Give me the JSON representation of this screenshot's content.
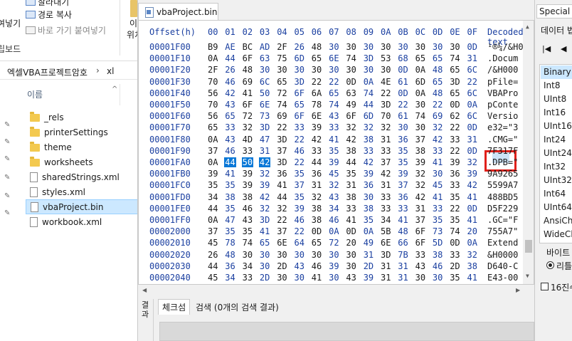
{
  "explorer": {
    "ribbon": {
      "item_top": "잘라내기",
      "copy_path": "경로 복사",
      "paste_shortcut": "바로 가기 붙여넣기",
      "left_fragment": "여넣기",
      "clipboard_group": "립보드",
      "right_fragment_1": "이",
      "right_fragment_2": "위치"
    },
    "breadcrumb": [
      "엑셀VBA프로젝트암호",
      "xl"
    ],
    "column_header": "이름",
    "files": [
      {
        "name": "_rels",
        "type": "folder"
      },
      {
        "name": "printerSettings",
        "type": "folder"
      },
      {
        "name": "theme",
        "type": "folder"
      },
      {
        "name": "worksheets",
        "type": "folder"
      },
      {
        "name": "sharedStrings.xml",
        "type": "file"
      },
      {
        "name": "styles.xml",
        "type": "file"
      },
      {
        "name": "vbaProject.bin",
        "type": "file",
        "selected": true
      },
      {
        "name": "workbook.xml",
        "type": "file"
      }
    ]
  },
  "editor": {
    "tab_title": "vbaProject.bin",
    "header": {
      "offset": "Offset(h)",
      "columns": [
        "00",
        "01",
        "02",
        "03",
        "04",
        "05",
        "06",
        "07",
        "08",
        "09",
        "0A",
        "0B",
        "0C",
        "0D",
        "0E",
        "0F"
      ],
      "decoded": "Decoded text"
    },
    "rows": [
      {
        "offset": "00001F00",
        "bytes": [
          "B9",
          "AE",
          "BC",
          "AD",
          "2F",
          "26",
          "48",
          "30",
          "30",
          "30",
          "30",
          "30",
          "30",
          "30",
          "30",
          "0D"
        ],
        "decoded": "¹®¼­/&H0"
      },
      {
        "offset": "00001F10",
        "bytes": [
          "0A",
          "44",
          "6F",
          "63",
          "75",
          "6D",
          "65",
          "6E",
          "74",
          "3D",
          "53",
          "68",
          "65",
          "65",
          "74",
          "31"
        ],
        "decoded": ".Docum"
      },
      {
        "offset": "00001F20",
        "bytes": [
          "2F",
          "26",
          "48",
          "30",
          "30",
          "30",
          "30",
          "30",
          "30",
          "30",
          "30",
          "0D",
          "0A",
          "48",
          "65",
          "6C"
        ],
        "decoded": "/&H000"
      },
      {
        "offset": "00001F30",
        "bytes": [
          "70",
          "46",
          "69",
          "6C",
          "65",
          "3D",
          "22",
          "22",
          "0D",
          "0A",
          "4E",
          "61",
          "6D",
          "65",
          "3D",
          "22"
        ],
        "decoded": "pFile="
      },
      {
        "offset": "00001F40",
        "bytes": [
          "56",
          "42",
          "41",
          "50",
          "72",
          "6F",
          "6A",
          "65",
          "63",
          "74",
          "22",
          "0D",
          "0A",
          "48",
          "65",
          "6C"
        ],
        "decoded": "VBAPro"
      },
      {
        "offset": "00001F50",
        "bytes": [
          "70",
          "43",
          "6F",
          "6E",
          "74",
          "65",
          "78",
          "74",
          "49",
          "44",
          "3D",
          "22",
          "30",
          "22",
          "0D",
          "0A"
        ],
        "decoded": "pConte"
      },
      {
        "offset": "00001F60",
        "bytes": [
          "56",
          "65",
          "72",
          "73",
          "69",
          "6F",
          "6E",
          "43",
          "6F",
          "6D",
          "70",
          "61",
          "74",
          "69",
          "62",
          "6C"
        ],
        "decoded": "Versio"
      },
      {
        "offset": "00001F70",
        "bytes": [
          "65",
          "33",
          "32",
          "3D",
          "22",
          "33",
          "39",
          "33",
          "32",
          "32",
          "32",
          "30",
          "30",
          "32",
          "22",
          "0D"
        ],
        "decoded": "e32=\"3"
      },
      {
        "offset": "00001F80",
        "bytes": [
          "0A",
          "43",
          "4D",
          "47",
          "3D",
          "22",
          "42",
          "41",
          "42",
          "38",
          "31",
          "36",
          "37",
          "42",
          "33",
          "31"
        ],
        "decoded": ".CMG=\""
      },
      {
        "offset": "00001F90",
        "bytes": [
          "37",
          "46",
          "33",
          "31",
          "37",
          "46",
          "33",
          "35",
          "38",
          "33",
          "33",
          "35",
          "38",
          "33",
          "22",
          "0D"
        ],
        "decoded": "7F317F"
      },
      {
        "offset": "00001FA0",
        "bytes": [
          "0A",
          "44",
          "50",
          "42",
          "3D",
          "22",
          "44",
          "39",
          "44",
          "42",
          "37",
          "35",
          "39",
          "41",
          "39",
          "32"
        ],
        "decoded": ".DPB=\"",
        "selected_columns": [
          1,
          2,
          3
        ]
      },
      {
        "offset": "00001FB0",
        "bytes": [
          "39",
          "41",
          "39",
          "32",
          "36",
          "35",
          "36",
          "45",
          "35",
          "39",
          "42",
          "39",
          "32",
          "30",
          "36",
          "39"
        ],
        "decoded": "9A9265"
      },
      {
        "offset": "00001FC0",
        "bytes": [
          "35",
          "35",
          "39",
          "39",
          "41",
          "37",
          "31",
          "32",
          "31",
          "36",
          "31",
          "37",
          "32",
          "45",
          "33",
          "42"
        ],
        "decoded": "5599A7"
      },
      {
        "offset": "00001FD0",
        "bytes": [
          "34",
          "38",
          "38",
          "42",
          "44",
          "35",
          "32",
          "43",
          "38",
          "30",
          "33",
          "36",
          "42",
          "41",
          "35",
          "41"
        ],
        "decoded": "488BD5"
      },
      {
        "offset": "00001FE0",
        "bytes": [
          "44",
          "35",
          "46",
          "32",
          "32",
          "39",
          "38",
          "34",
          "33",
          "38",
          "33",
          "33",
          "31",
          "33",
          "22",
          "0D"
        ],
        "decoded": "D5F229"
      },
      {
        "offset": "00001FF0",
        "bytes": [
          "0A",
          "47",
          "43",
          "3D",
          "22",
          "46",
          "38",
          "46",
          "41",
          "35",
          "34",
          "41",
          "37",
          "35",
          "35",
          "41"
        ],
        "decoded": ".GC=\"F"
      },
      {
        "offset": "00002000",
        "bytes": [
          "37",
          "35",
          "35",
          "41",
          "37",
          "22",
          "0D",
          "0A",
          "0D",
          "0A",
          "5B",
          "48",
          "6F",
          "73",
          "74",
          "20"
        ],
        "decoded": "755A7\""
      },
      {
        "offset": "00002010",
        "bytes": [
          "45",
          "78",
          "74",
          "65",
          "6E",
          "64",
          "65",
          "72",
          "20",
          "49",
          "6E",
          "66",
          "6F",
          "5D",
          "0D",
          "0A"
        ],
        "decoded": "Extend"
      },
      {
        "offset": "00002020",
        "bytes": [
          "26",
          "48",
          "30",
          "30",
          "30",
          "30",
          "30",
          "30",
          "30",
          "31",
          "3D",
          "7B",
          "33",
          "38",
          "33",
          "32"
        ],
        "decoded": "&H0000"
      },
      {
        "offset": "00002030",
        "bytes": [
          "44",
          "36",
          "34",
          "30",
          "2D",
          "43",
          "46",
          "39",
          "30",
          "2D",
          "31",
          "31",
          "43",
          "46",
          "2D",
          "38"
        ],
        "decoded": "D640-C"
      },
      {
        "offset": "00002040",
        "bytes": [
          "45",
          "34",
          "33",
          "2D",
          "30",
          "30",
          "41",
          "30",
          "43",
          "39",
          "31",
          "31",
          "30",
          "30",
          "35",
          "41"
        ],
        "decoded": "E43-00"
      }
    ]
  },
  "results": {
    "side_label": "결과",
    "tabs": [
      "체크섬",
      "검색 (0개의 검색 결과)"
    ]
  },
  "inspector": {
    "tab_label": "Special e",
    "title": "데이터 법",
    "nav_buttons": [
      "first",
      "prev"
    ],
    "types": [
      "Binary (",
      "Int8",
      "UInt8",
      "Int16",
      "UInt16",
      "Int24",
      "UInt24",
      "Int32",
      "UInt32",
      "Int64",
      "UInt64",
      "AnsiCha",
      "WideCh"
    ],
    "selected_type_index": 0,
    "byte_order_label": "바이트",
    "radio_label": "리틀",
    "checkbox_label": "16진수"
  }
}
